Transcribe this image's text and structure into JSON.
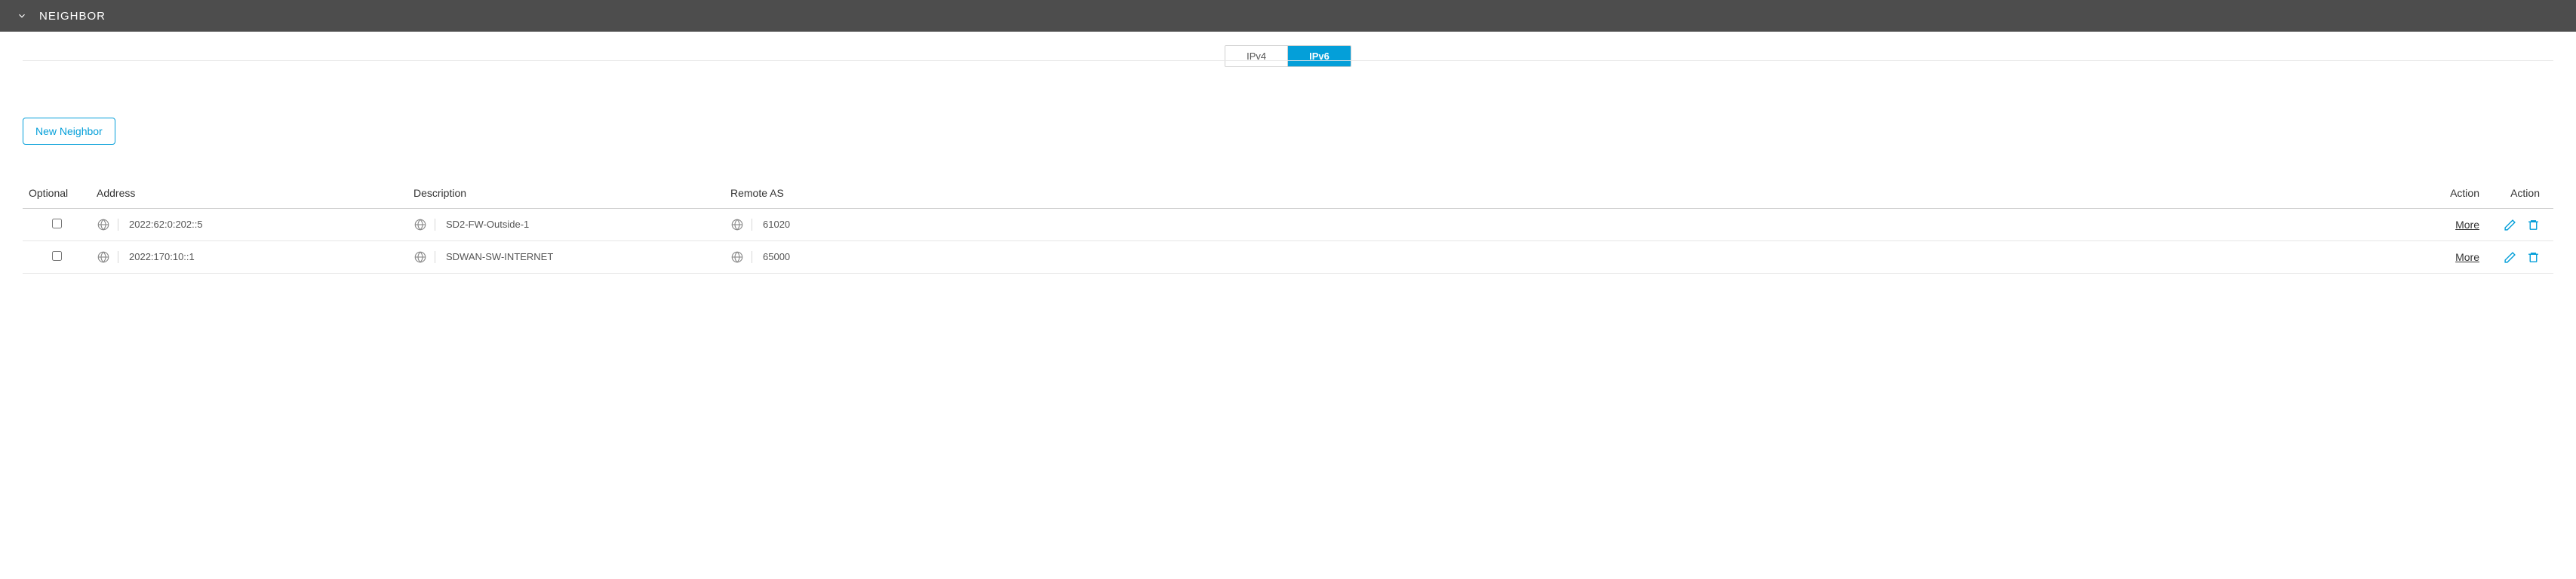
{
  "section": {
    "title": "NEIGHBOR"
  },
  "tabs": {
    "ipv4": "IPv4",
    "ipv6": "IPv6",
    "active": "ipv6"
  },
  "buttons": {
    "new_neighbor": "New Neighbor",
    "more": "More"
  },
  "table": {
    "headers": {
      "optional": "Optional",
      "address": "Address",
      "description": "Description",
      "remote_as": "Remote AS",
      "action1": "Action",
      "action2": "Action"
    },
    "rows": [
      {
        "address": "2022:62:0:202::5",
        "description": "SD2-FW-Outside-1",
        "remote_as": "61020"
      },
      {
        "address": "2022:170:10::1",
        "description": "SDWAN-SW-INTERNET",
        "remote_as": "65000"
      }
    ]
  }
}
